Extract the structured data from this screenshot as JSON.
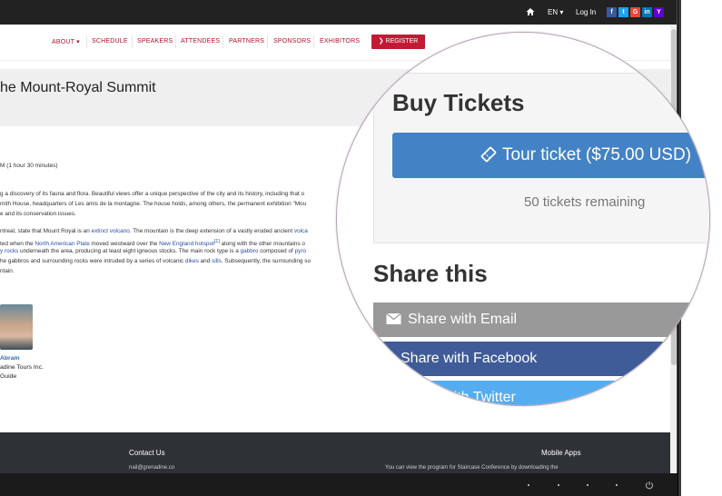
{
  "topbar": {
    "lang_label": "EN ▾",
    "login_label": "Log In",
    "social": [
      {
        "name": "facebook",
        "glyph": "f",
        "color": "#3b5998"
      },
      {
        "name": "twitter",
        "glyph": "t",
        "color": "#1da1f2"
      },
      {
        "name": "google",
        "glyph": "G",
        "color": "#dd4b39"
      },
      {
        "name": "linkedin",
        "glyph": "in",
        "color": "#0077b5"
      },
      {
        "name": "yahoo",
        "glyph": "Y",
        "color": "#5f01d1"
      }
    ]
  },
  "nav": {
    "items": [
      "ABOUT ▾",
      "SCHEDULE",
      "SPEAKERS",
      "ATTENDEES",
      "PARTNERS",
      "SPONSORS",
      "EXHIBITORS"
    ],
    "register_label": "❯ REGISTER"
  },
  "page": {
    "title": "he Mount-Royal Summit",
    "duration": "M (1 hour 30 minutes)",
    "para1": [
      "g a discovery of its fauna and flora. Beautiful views offer a unique perspective of the city and its history, including that o",
      "mith House, headquarters of Les amis de la montagne. The house holds, among others, the permanent exhibition \"Mou",
      "e and its conservation issues."
    ],
    "para2": {
      "l1_a": "ntreal, state that Mount Royal is an ",
      "l1_link": "extinct volcano",
      "l1_b": ". The mountain is the deep extension of a vastly eroded ancient ",
      "l1_link2": "volca",
      "l2_a": "ted when the ",
      "l2_link": "North American Plate",
      "l2_b": " moved westward over the ",
      "l2_link2": "New England hotspot",
      "l2_sup": "[1]",
      "l2_c": " along with the other mountains o",
      "l3_link": "y rocks",
      "l3_a": " underneath the area, producing at least eight igneous stocks. The main rock type is a ",
      "l3_link2": "gabbro",
      "l3_b": " composed of ",
      "l3_link3": "pyro",
      "l4_a": "he gabbros and surrounding rocks were intruded by a series of volcanic ",
      "l4_link": "dikes",
      "l4_b": " and ",
      "l4_link2": "sills",
      "l4_c": ". Subsequently, the surrounding so",
      "l5": "ntain."
    },
    "organizer": {
      "name": "Abram",
      "company": "adine Tours Inc.",
      "role": "Guide"
    }
  },
  "footer": {
    "contact_heading": "Contact Us",
    "contact_text": "nail@grenadine.co",
    "apps_heading": "Mobile Apps",
    "apps_text": "You can view the program for Staircase Conference by downloading the"
  },
  "magnifier": {
    "buy_heading": "Buy Tickets",
    "ticket_label": "Tour ticket ($75.00 USD)",
    "remaining": "50 tickets remaining",
    "share_heading": "Share this",
    "share_email": "Share with Email",
    "share_facebook": "Share with Facebook",
    "share_twitter": "Share with Twitter"
  }
}
